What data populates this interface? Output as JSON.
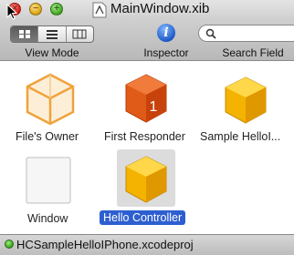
{
  "window": {
    "title": "MainWindow.xib"
  },
  "toolbar": {
    "view_mode_label": "View Mode",
    "inspector_label": "Inspector",
    "inspector_glyph": "i",
    "search_label": "Search Field",
    "search_value": ""
  },
  "objects": [
    {
      "label": "File's Owner",
      "icon": "transparent-cube-icon"
    },
    {
      "label": "First Responder",
      "icon": "red-cube-icon",
      "badge": "1"
    },
    {
      "label": "Sample HelloI...",
      "icon": "yellow-cube-icon"
    },
    {
      "label": "Window",
      "icon": "window-icon"
    },
    {
      "label": "Hello Controller",
      "icon": "yellow-cube-icon",
      "selected": true
    }
  ],
  "status": {
    "project": "HCSampleHelloIPhone.xcodeproj"
  },
  "colors": {
    "selection": "#2e5fd1",
    "accent_yellow": "#f3b300",
    "accent_red": "#d84a14"
  }
}
